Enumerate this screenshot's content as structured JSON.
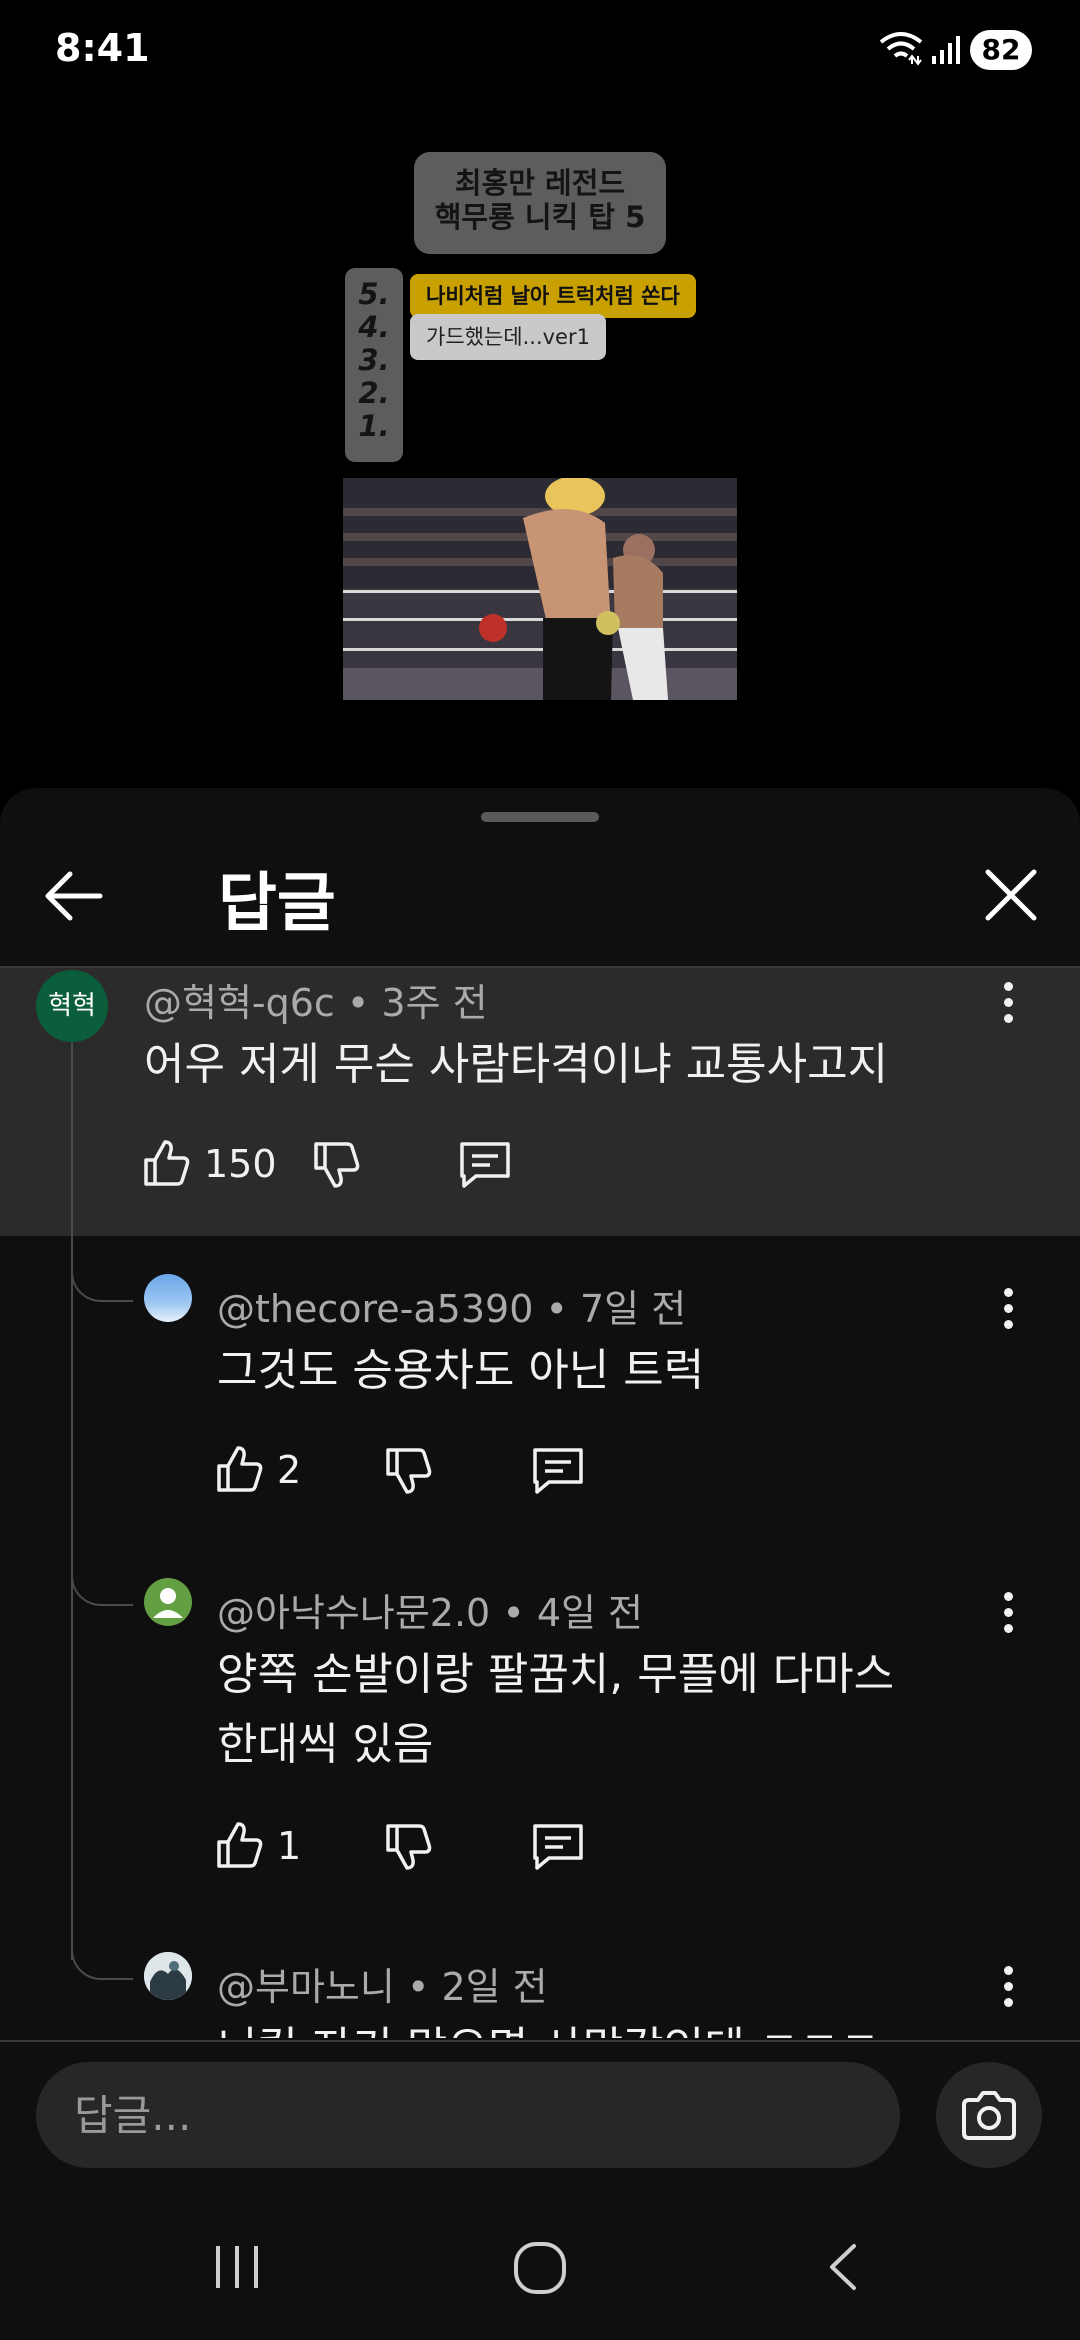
{
  "status_bar": {
    "time": "8:41",
    "battery": "82"
  },
  "video": {
    "title_card": [
      "최홍만 레전드",
      "핵무룡 니킥 탑 5"
    ],
    "ranks": [
      "5.",
      "4.",
      "3.",
      "2.",
      "1."
    ],
    "entry_5": "나비처럼 날아 트럭처럼 쏜다",
    "entry_4": "가드했는데...ver1"
  },
  "sheet": {
    "title": "답글"
  },
  "parent_comment": {
    "avatar_text": "혁혁",
    "author": "@혁혁-q6c",
    "time": "3주 전",
    "text": "어우 저게 무슨 사람타격이냐 교통사고지",
    "likes": "150"
  },
  "replies": [
    {
      "author": "@thecore-a5390",
      "time": "7일 전",
      "lines": [
        "그것도 승용차도 아닌 트럭"
      ],
      "likes": "2"
    },
    {
      "author": "@아낙수나문2.0",
      "time": "4일 전",
      "lines": [
        "양쪽 손발이랑 팔꿈치, 무플에 다마스",
        "한대씩 있음"
      ],
      "likes": "1"
    },
    {
      "author": "@부마노니",
      "time": "2일 전",
      "lines": [
        "니킥 자기 맞으면 사망각인데 ㅋㅋㅋ"
      ],
      "likes": ""
    }
  ],
  "input": {
    "placeholder": "답글..."
  },
  "colors": {
    "background": "#0f0f0f",
    "highlight": "#2b2b2b",
    "meta": "#aaaaaa",
    "text": "#f1f1f1"
  },
  "icons": [
    "back-arrow-icon",
    "close-icon",
    "like-icon",
    "dislike-icon",
    "reply-icon",
    "more-vert-icon",
    "camera-icon",
    "wifi-icon",
    "signal-icon"
  ]
}
